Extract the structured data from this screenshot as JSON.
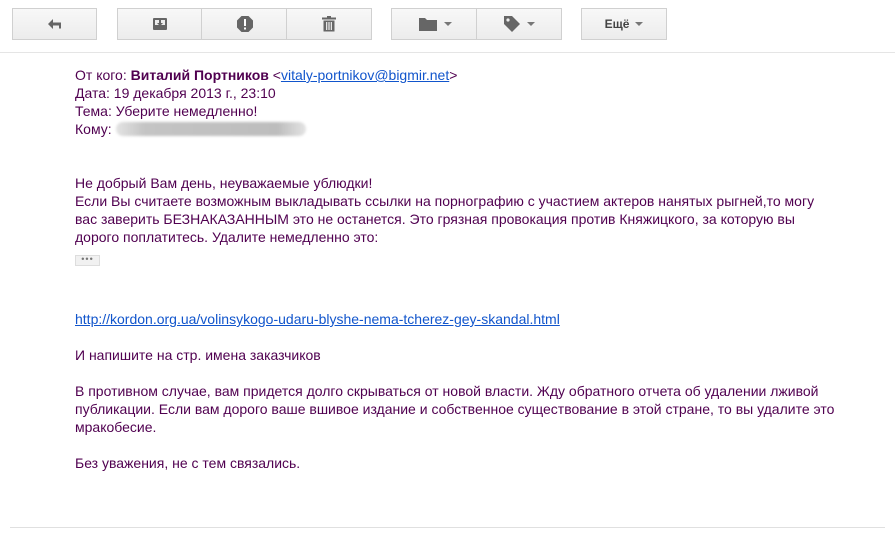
{
  "toolbar": {
    "buttons": [
      {
        "name": "reply-button",
        "icon": "reply-icon"
      },
      {
        "name": "archive-button",
        "icon": "archive-icon"
      },
      {
        "name": "report-spam-button",
        "icon": "report-spam-icon"
      },
      {
        "name": "delete-button",
        "icon": "trash-icon"
      },
      {
        "name": "move-to-button",
        "icon": "folder-icon"
      },
      {
        "name": "labels-button",
        "icon": "tag-icon"
      }
    ],
    "more_label": "Ещё"
  },
  "email": {
    "from_label": "От кого:",
    "from_name": "Виталий Портников",
    "from_email": "vitaly-portnikov@bigmir.net",
    "date_label": "Дата:",
    "date_value": "19 декабря 2013 г., 23:10",
    "subject_label": "Тема:",
    "subject_value": "Уберите немедленно!",
    "to_label": "Кому:",
    "greeting": "Не добрый Вам день, неуважаемые ублюдки!",
    "paragraph1": "Если Вы считаете возможным выкладывать ссылки на порнографию с участием актеров нанятых рыгней,то могу вас заверить БЕЗНАКАЗАННЫМ это не останется. Это грязная провокация против Княжицкого, за которую вы дорого поплатитесь. Удалите немедленно это:",
    "link": "http://kordon.org.ua/volinsykogo-udaru-blyshe-nema-tcherez-gey-skandal.html",
    "paragraph2": "И напишите на стр. имена заказчиков",
    "paragraph3": "В противном случае, вам придется долго скрываться от новой власти. Жду обратного отчета об удалении лживой публикации. Если вам дорого ваше вшивое издание и собственное существование в этой стране, то вы удалите это мракобесие.",
    "signoff": "Без уважения, не с тем связались."
  }
}
